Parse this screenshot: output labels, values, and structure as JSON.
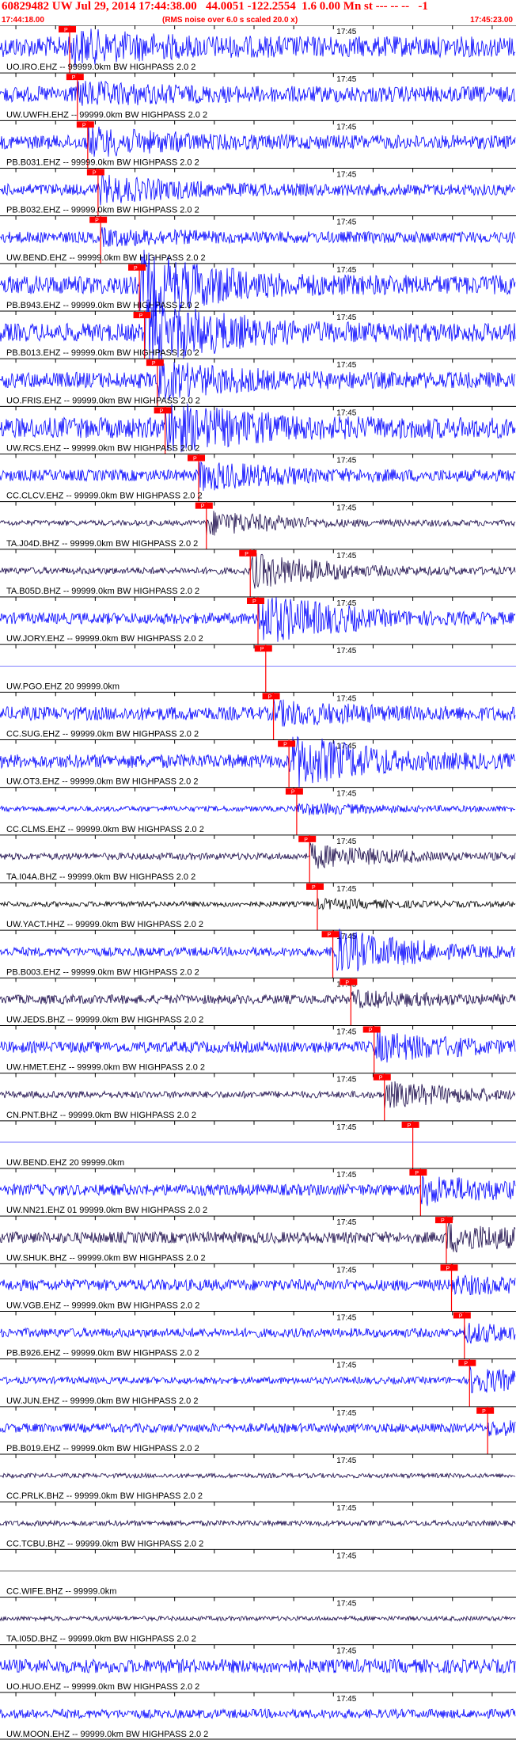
{
  "header": {
    "title": "60829482 UW Jul 29, 2014 17:44:38.00   44.0051 -122.2554  1.6 0.00 Mn st --- -- --   -1",
    "start_time": "17:44:18.00",
    "note": "(RMS noise over 6.0 s scaled 20.0 x)",
    "end_time": "17:45:23.00"
  },
  "chart_data": {
    "type": "seismogram",
    "time_axis": {
      "start": "17:44:18.00",
      "end": "17:45:23.00",
      "tick_label": "17:45"
    },
    "pick_label": "P",
    "colors": {
      "blue": "#0000ff",
      "dark": "#1a0a4a",
      "black": "#000000",
      "pick": "#ff0000"
    },
    "traces": [
      {
        "label": "UO.IRO.EHZ -- 99999.0km BW  HIGHPASS  2.0  2",
        "color": "blue",
        "amp": 0.45,
        "burst": 0.45,
        "pick": 0.135
      },
      {
        "label": "UW.UWFH.EHZ -- 99999.0km BW  HIGHPASS  2.0  2",
        "color": "blue",
        "amp": 0.35,
        "burst": 0.3,
        "pick": 0.15
      },
      {
        "label": "PB.B031.EHZ -- 99999.0km BW  HIGHPASS  2.0  2",
        "color": "blue",
        "amp": 0.3,
        "burst": 0.45,
        "pick": 0.17
      },
      {
        "label": "PB.B032.EHZ -- 99999.0km BW  HIGHPASS  2.0  2",
        "color": "blue",
        "amp": 0.25,
        "burst": 0.45,
        "pick": 0.19
      },
      {
        "label": "UW.BEND.EHZ -- 99999.0km BW  HIGHPASS  2.0  2",
        "color": "blue",
        "amp": 0.25,
        "burst": 0.2,
        "pick": 0.195
      },
      {
        "label": "PB.B943.EHZ -- 99999.0km BW  HIGHPASS  2.0  2",
        "color": "blue",
        "amp": 0.4,
        "burst": 1.2,
        "pick": 0.27
      },
      {
        "label": "PB.B013.EHZ -- 99999.0km BW  HIGHPASS  2.0  2",
        "color": "blue",
        "amp": 0.4,
        "burst": 1.2,
        "pick": 0.28
      },
      {
        "label": "UO.FRIS.EHZ -- 99999.0km BW  HIGHPASS  2.0  2",
        "color": "blue",
        "amp": 0.35,
        "burst": 0.6,
        "pick": 0.305
      },
      {
        "label": "UW.RCS.EHZ -- 99999.0km BW  HIGHPASS  2.0  2",
        "color": "blue",
        "amp": 0.45,
        "burst": 0.8,
        "pick": 0.32
      },
      {
        "label": "CC.CLCV.EHZ -- 99999.0km BW  HIGHPASS  2.0  2",
        "color": "blue",
        "amp": 0.25,
        "burst": 0.5,
        "pick": 0.385
      },
      {
        "label": "TA.J04D.BHZ -- 99999.0km BW  HIGHPASS  2.0  2",
        "color": "dark",
        "amp": 0.12,
        "burst": 0.5,
        "pick": 0.4
      },
      {
        "label": "TA.B05D.BHZ -- 99999.0km BW  HIGHPASS  2.0  2",
        "color": "dark",
        "amp": 0.15,
        "burst": 0.7,
        "pick": 0.485
      },
      {
        "label": "UW.JORY.EHZ -- 99999.0km BW  HIGHPASS  2.0  2",
        "color": "blue",
        "amp": 0.25,
        "burst": 1.0,
        "pick": 0.5
      },
      {
        "label": "UW.PGO.EHZ 20 99999.0km",
        "color": "blue",
        "amp": 0.0,
        "burst": 0.0,
        "pick": 0.515
      },
      {
        "label": "CC.SUG.EHZ -- 99999.0km BW  HIGHPASS  2.0  2",
        "color": "blue",
        "amp": 0.3,
        "burst": 0.35,
        "pick": 0.53
      },
      {
        "label": "UW.OT3.EHZ -- 99999.0km BW  HIGHPASS  2.0  2",
        "color": "blue",
        "amp": 0.3,
        "burst": 1.0,
        "pick": 0.56
      },
      {
        "label": "CC.CLMS.EHZ -- 99999.0km BW  HIGHPASS  2.0  2",
        "color": "blue",
        "amp": 0.12,
        "burst": 0.2,
        "pick": 0.575
      },
      {
        "label": "TA.I04A.BHZ -- 99999.0km BW  HIGHPASS  2.0  2",
        "color": "dark",
        "amp": 0.15,
        "burst": 0.45,
        "pick": 0.6
      },
      {
        "label": "UW.YACT.HHZ -- 99999.0km BW  HIGHPASS  2.0  2",
        "color": "black",
        "amp": 0.12,
        "burst": 0.15,
        "pick": 0.615
      },
      {
        "label": "PB.B003.EHZ -- 99999.0km BW  HIGHPASS  2.0  2",
        "color": "blue",
        "amp": 0.2,
        "burst": 0.9,
        "pick": 0.645
      },
      {
        "label": "UW.JEDS.BHZ -- 99999.0km BW  HIGHPASS  2.0  2",
        "color": "dark",
        "amp": 0.2,
        "burst": 0.25,
        "pick": 0.68
      },
      {
        "label": "UW.HMET.EHZ -- 99999.0km BW  HIGHPASS  2.0  2",
        "color": "blue",
        "amp": 0.25,
        "burst": 0.5,
        "pick": 0.725
      },
      {
        "label": "CN.PNT.BHZ -- 99999.0km BW  HIGHPASS  2.0  2",
        "color": "dark",
        "amp": 0.15,
        "burst": 0.5,
        "pick": 0.745
      },
      {
        "label": "UW.BEND.EHZ 20 99999.0km",
        "color": "blue",
        "amp": 0.0,
        "burst": 0.0,
        "pick": 0.8
      },
      {
        "label": "UW.NN21.EHZ 01 99999.0km BW  HIGHPASS  2.0  2",
        "color": "blue",
        "amp": 0.25,
        "burst": 0.5,
        "pick": 0.815
      },
      {
        "label": "UW.SHUK.BHZ -- 99999.0km BW  HIGHPASS  2.0  2",
        "color": "dark",
        "amp": 0.25,
        "burst": 0.5,
        "pick": 0.865
      },
      {
        "label": "UW.VGB.EHZ -- 99999.0km BW  HIGHPASS  2.0  2",
        "color": "blue",
        "amp": 0.25,
        "burst": 0.25,
        "pick": 0.875
      },
      {
        "label": "PB.B926.EHZ -- 99999.0km BW  HIGHPASS  2.0  2",
        "color": "blue",
        "amp": 0.2,
        "burst": 0.3,
        "pick": 0.9
      },
      {
        "label": "UW.JUN.EHZ -- 99999.0km BW  HIGHPASS  2.0  2",
        "color": "blue",
        "amp": 0.15,
        "burst": 0.5,
        "pick": 0.91
      },
      {
        "label": "PB.B019.EHZ -- 99999.0km BW  HIGHPASS  2.0  2",
        "color": "blue",
        "amp": 0.2,
        "burst": 0.2,
        "pick": 0.945
      },
      {
        "label": "CC.PRLK.BHZ -- 99999.0km BW  HIGHPASS  2.0  2",
        "color": "dark",
        "amp": 0.1,
        "burst": 0.0,
        "pick": null
      },
      {
        "label": "CC.TCBU.BHZ -- 99999.0km BW  HIGHPASS  2.0  2",
        "color": "dark",
        "amp": 0.12,
        "burst": 0.0,
        "pick": null
      },
      {
        "label": "CC.WIFE.BHZ -- 99999.0km",
        "color": "black",
        "amp": 0.0,
        "burst": 0.0,
        "pick": null
      },
      {
        "label": "TA.I05D.BHZ -- 99999.0km BW  HIGHPASS  2.0  2",
        "color": "dark",
        "amp": 0.1,
        "burst": 0.0,
        "pick": null
      },
      {
        "label": "UO.HUO.EHZ -- 99999.0km BW  HIGHPASS  2.0  2",
        "color": "blue",
        "amp": 0.3,
        "burst": 0.3,
        "pick": null
      },
      {
        "label": "UW.MOON.EHZ -- 99999.0km BW  HIGHPASS  2.0  2",
        "color": "blue",
        "amp": 0.2,
        "burst": 0.0,
        "pick": null
      }
    ]
  }
}
